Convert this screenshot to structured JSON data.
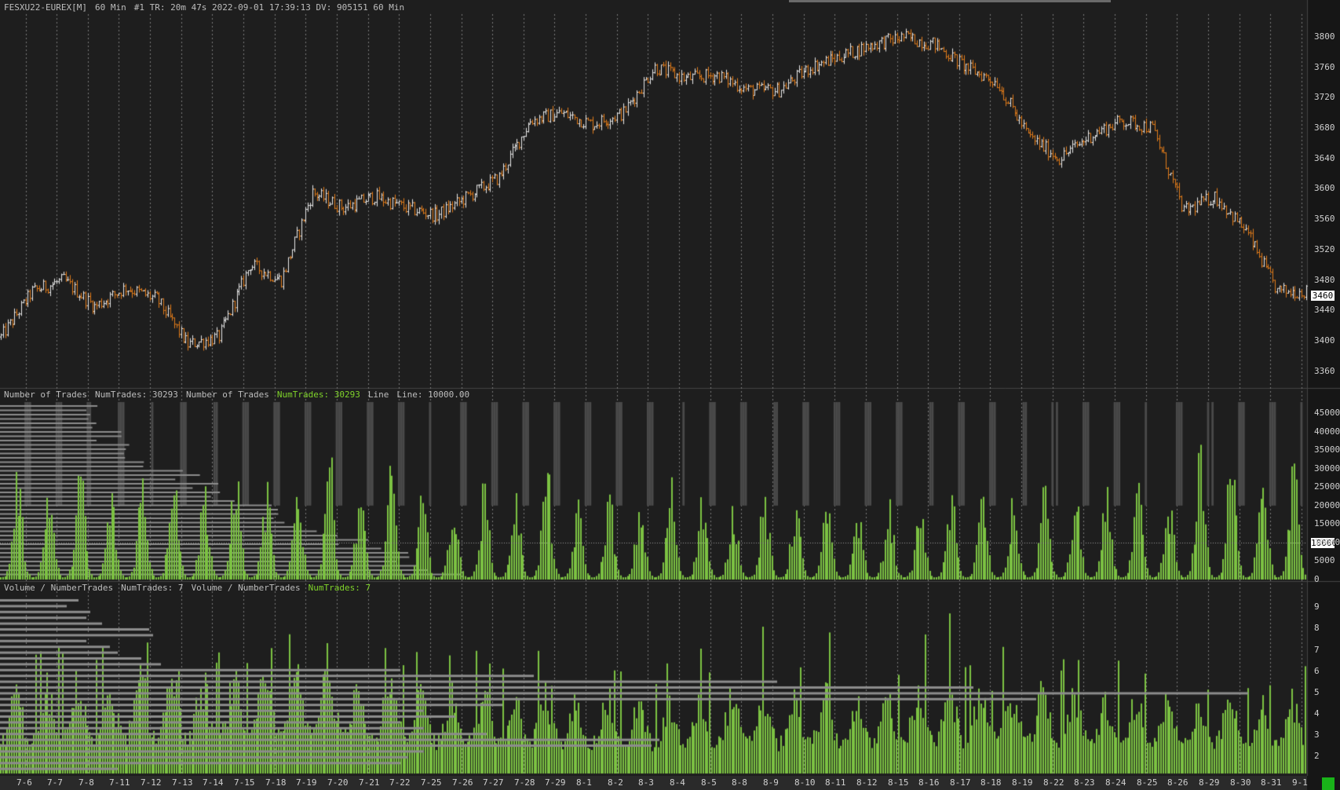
{
  "main_header": {
    "symbol": "FESXU22-EUREX[M]",
    "interval": "60 Min",
    "info": "#1 TR: 20m 47s 2022-09-01 17:39:13 DV: 905151 60 Min"
  },
  "trades_header": {
    "study1": "Number of Trades",
    "value1": "NumTrades: 30293",
    "study2": "Number of Trades",
    "value2": "NumTrades: 30293",
    "line_name": "Line",
    "line_value": "Line: 10000.00"
  },
  "volume_header": {
    "study1": "Volume / NumberTrades",
    "value1": "NumTrades: 7",
    "study2": "Volume / NumberTrades",
    "value2": "NumTrades: 7"
  },
  "current_price_label": "3460",
  "line_level_label": "10000",
  "colors": {
    "background": "#1e1e1e",
    "up_bar": "#e8e8e8",
    "down_bar": "#e07b1a",
    "histogram": "#7cc242",
    "profile": "#8c8c8c",
    "grid": "#7a7a7a",
    "status_green": "#19b319"
  },
  "chart_data": [
    {
      "type": "line",
      "title": "FESXU22-EUREX[M] 60 Min",
      "style": "ohlc_bars",
      "ylim": [
        3340,
        3830
      ],
      "yticks": [
        3360,
        3400,
        3440,
        3480,
        3520,
        3560,
        3600,
        3640,
        3680,
        3720,
        3760,
        3800
      ],
      "x": [
        "7-6",
        "7-7",
        "7-8",
        "7-11",
        "7-12",
        "7-13",
        "7-14",
        "7-15",
        "7-18",
        "7-19",
        "7-20",
        "7-21",
        "7-22",
        "7-25",
        "7-26",
        "7-27",
        "7-28",
        "7-29",
        "8-1",
        "8-2",
        "8-3",
        "8-4",
        "8-5",
        "8-8",
        "8-9",
        "8-10",
        "8-11",
        "8-12",
        "8-15",
        "8-16",
        "8-17",
        "8-18",
        "8-19",
        "8-22",
        "8-23",
        "8-24",
        "8-25",
        "8-26",
        "8-29",
        "8-30",
        "8-31",
        "9-1"
      ],
      "series": [
        {
          "values": [
            3405,
            3465,
            3480,
            3445,
            3470,
            3455,
            3395,
            3405,
            3500,
            3480,
            3595,
            3575,
            3590,
            3575,
            3565,
            3590,
            3615,
            3690,
            3700,
            3685,
            3700,
            3760,
            3745,
            3750,
            3730,
            3730,
            3760,
            3775,
            3790,
            3800,
            3790,
            3760,
            3740,
            3670,
            3640,
            3670,
            3690,
            3680,
            3570,
            3590,
            3545,
            3465
          ]
        }
      ],
      "grid": true
    },
    {
      "type": "bar",
      "title": "Number of Trades",
      "ylim": [
        0,
        48000
      ],
      "yticks": [
        0,
        5000,
        10000,
        15000,
        20000,
        25000,
        30000,
        35000,
        40000,
        45000
      ],
      "reference_line": 10000,
      "x": [
        "7-6",
        "7-7",
        "7-8",
        "7-11",
        "7-12",
        "7-13",
        "7-14",
        "7-15",
        "7-18",
        "7-19",
        "7-20",
        "7-21",
        "7-22",
        "7-25",
        "7-26",
        "7-27",
        "7-28",
        "7-29",
        "8-1",
        "8-2",
        "8-3",
        "8-4",
        "8-5",
        "8-8",
        "8-9",
        "8-10",
        "8-11",
        "8-12",
        "8-15",
        "8-16",
        "8-17",
        "8-18",
        "8-19",
        "8-22",
        "8-23",
        "8-24",
        "8-25",
        "8-26",
        "8-29",
        "8-30",
        "8-31",
        "9-1"
      ],
      "series": [
        {
          "name": "NumTrades",
          "values": [
            28000,
            25000,
            30000,
            22000,
            27000,
            32000,
            25000,
            30000,
            23000,
            26000,
            35000,
            24000,
            28000,
            21000,
            20000,
            24000,
            22000,
            30000,
            19000,
            22000,
            20000,
            25000,
            22000,
            20000,
            21000,
            20000,
            19000,
            18000,
            20000,
            19000,
            21000,
            22000,
            20000,
            24000,
            21000,
            22000,
            23000,
            21000,
            36000,
            32000,
            33000,
            30000
          ]
        }
      ]
    },
    {
      "type": "bar",
      "title": "Volume / NumberTrades",
      "ylim": [
        1.2,
        9.6
      ],
      "yticks": [
        2,
        3,
        4,
        5,
        6,
        7,
        8,
        9
      ],
      "x": [
        "7-6",
        "7-7",
        "7-8",
        "7-11",
        "7-12",
        "7-13",
        "7-14",
        "7-15",
        "7-18",
        "7-19",
        "7-20",
        "7-21",
        "7-22",
        "7-25",
        "7-26",
        "7-27",
        "7-28",
        "7-29",
        "8-1",
        "8-2",
        "8-3",
        "8-4",
        "8-5",
        "8-8",
        "8-9",
        "8-10",
        "8-11",
        "8-12",
        "8-15",
        "8-16",
        "8-17",
        "8-18",
        "8-19",
        "8-22",
        "8-23",
        "8-24",
        "8-25",
        "8-26",
        "8-29",
        "8-30",
        "8-31",
        "9-1"
      ],
      "series": [
        {
          "name": "NumTrades",
          "values": [
            5.0,
            5.2,
            5.5,
            5.3,
            5.6,
            5.7,
            5.4,
            5.5,
            5.6,
            5.8,
            6.2,
            5.5,
            5.4,
            5.1,
            4.9,
            5.0,
            4.8,
            4.9,
            4.6,
            4.7,
            4.5,
            4.4,
            4.7,
            4.8,
            4.9,
            4.7,
            4.9,
            4.6,
            4.8,
            5.0,
            4.9,
            5.1,
            4.9,
            5.0,
            4.8,
            4.6,
            4.7,
            4.5,
            4.6,
            4.7,
            4.5,
            4.6
          ]
        }
      ]
    }
  ]
}
